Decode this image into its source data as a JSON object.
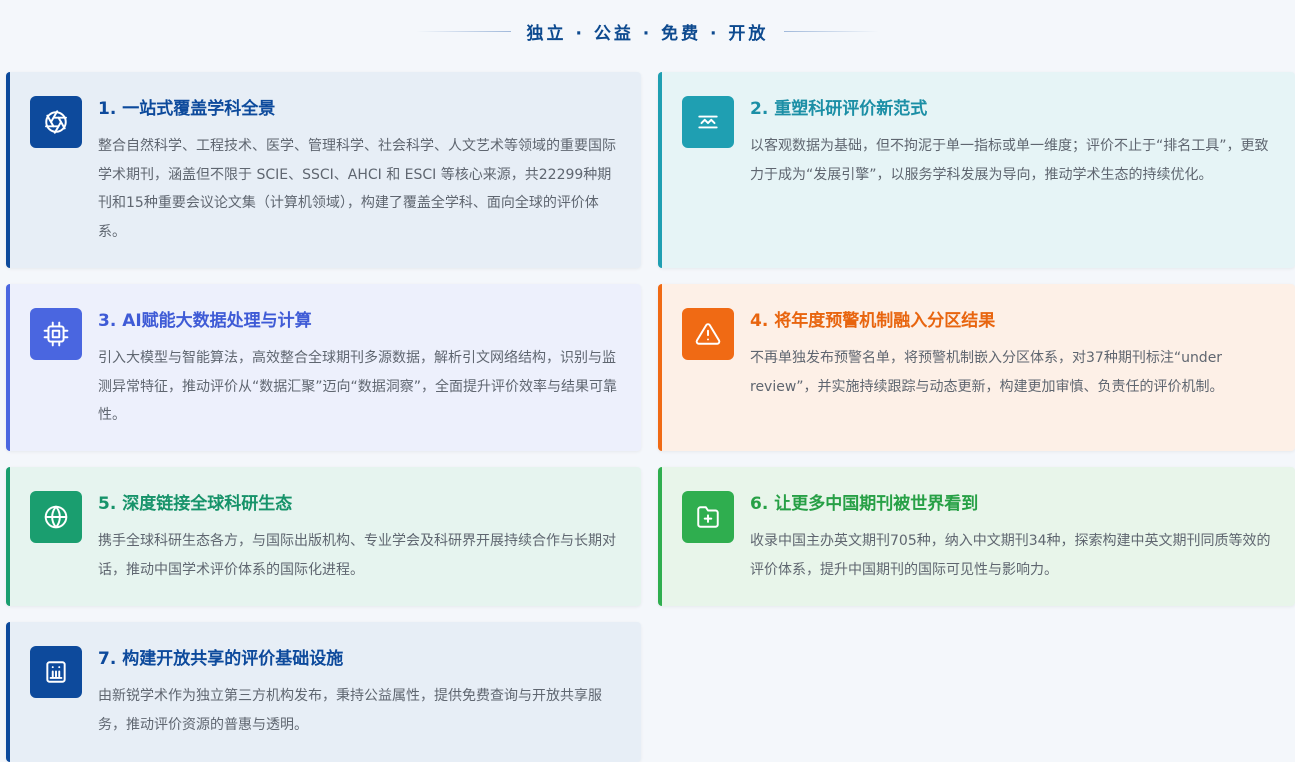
{
  "header": {
    "slogan": "独立 · 公益 · 免费 · 开放"
  },
  "cards": [
    {
      "title": "1. 一站式覆盖学科全景",
      "desc": "整合自然科学、工程技术、医学、管理科学、社会科学、人文艺术等领域的重要国际学术期刊，涵盖但不限于 SCIE、SSCI、AHCI 和 ESCI 等核心来源，共22299种期刊和15种重要会议论文集（计算机领域），构建了覆盖全学科、面向全球的评价体系。",
      "icon": "aperture-icon",
      "accent": "#0d4a9c",
      "bg": "#e7eef6",
      "title_color": "#0d4a9c"
    },
    {
      "title": "2. 重塑科研评价新范式",
      "desc": "以客观数据为基础，但不拘泥于单一指标或单一维度；评价不止于“排名工具”，更致力于成为“发展引擎”，以服务学科发展为导向，推动学术生态的持续优化。",
      "icon": "scale-icon",
      "accent": "#1f9fb2",
      "bg": "#e6f4f6",
      "title_color": "#1c8fa6"
    },
    {
      "title": "3. AI赋能大数据处理与计算",
      "desc": "引入大模型与智能算法，高效整合全球期刊多源数据，解析引文网络结构，识别与监测异常特征，推动评价从“数据汇聚”迈向“数据洞察”，全面提升评价效率与结果可靠性。",
      "icon": "cpu-icon",
      "accent": "#4a66e0",
      "bg": "#edf0fc",
      "title_color": "#3f5bd6"
    },
    {
      "title": "4. 将年度预警机制融入分区结果",
      "desc": "不再单独发布预警名单，将预警机制嵌入分区体系，对37种期刊标注“under review”，并实施持续跟踪与动态更新，构建更加审慎、负责任的评价机制。",
      "icon": "warning-icon",
      "accent": "#f06a14",
      "bg": "#fdf0e7",
      "title_color": "#e8650f"
    },
    {
      "title": "5. 深度链接全球科研生态",
      "desc": "携手全球科研生态各方，与国际出版机构、专业学会及科研界开展持续合作与长期对话，推动中国学术评价体系的国际化进程。",
      "icon": "globe-icon",
      "accent": "#1a9e6f",
      "bg": "#e6f4ef",
      "title_color": "#17936a"
    },
    {
      "title": "6. 让更多中国期刊被世界看到",
      "desc": "收录中国主办英文期刊705种，纳入中文期刊34种，探索构建中英文期刊同质等效的评价体系，提升中国期刊的国际可见性与影响力。",
      "icon": "folder-plus-icon",
      "accent": "#2fae4f",
      "bg": "#e8f5ea",
      "title_color": "#27a046"
    },
    {
      "title": "7. 构建开放共享的评价基础设施",
      "desc": "由新锐学术作为独立第三方机构发布，秉持公益属性，提供免费查询与开放共享服务，推动评价资源的普惠与透明。",
      "icon": "building-icon",
      "accent": "#0d4a9c",
      "bg": "#e7eef6",
      "title_color": "#0d4a9c"
    }
  ]
}
